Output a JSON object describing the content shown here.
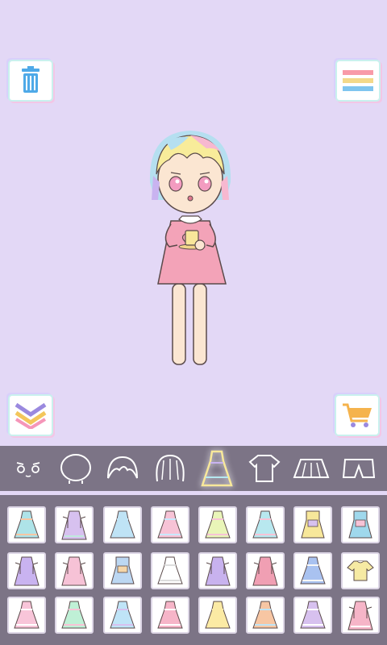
{
  "toolbar": {
    "trash_icon": "trash-icon",
    "menu_icon": "menu-icon",
    "collapse_icon": "chevron-down-icon",
    "shop_icon": "shopping-cart-icon"
  },
  "categories": [
    {
      "id": "face",
      "icon": "face-icon"
    },
    {
      "id": "head",
      "icon": "head-icon"
    },
    {
      "id": "bangs",
      "icon": "bangs-icon"
    },
    {
      "id": "hair",
      "icon": "hair-icon"
    },
    {
      "id": "dress",
      "icon": "dress-icon",
      "active": true
    },
    {
      "id": "tshirt",
      "icon": "tshirt-icon"
    },
    {
      "id": "skirt",
      "icon": "skirt-icon"
    },
    {
      "id": "pants",
      "icon": "pants-icon"
    }
  ],
  "items": [
    {
      "shape": "dress",
      "color": "#aee3e8",
      "trim": "#f7c6a3"
    },
    {
      "shape": "long-dress",
      "color": "#d7c1ef",
      "trim": "#bfe9dd"
    },
    {
      "shape": "dress",
      "color": "#bfe3f5",
      "trim": "#bfe3f5"
    },
    {
      "shape": "dress",
      "color": "#f7c3d6",
      "trim": "#c8e8ff"
    },
    {
      "shape": "dress",
      "color": "#e9f5b8",
      "trim": "#f7c3d6"
    },
    {
      "shape": "dress",
      "color": "#b8e8ef",
      "trim": "#f7c3d6"
    },
    {
      "shape": "overall",
      "color": "#f7e79a",
      "trim": "#d7c1ef"
    },
    {
      "shape": "overall",
      "color": "#9fd8ec",
      "trim": "#f7c3d6"
    },
    {
      "shape": "long-dress",
      "color": "#c9b3f0",
      "trim": "#c9b3f0"
    },
    {
      "shape": "long-dress",
      "color": "#f6c2d6",
      "trim": "#f6c2d6"
    },
    {
      "shape": "overall",
      "color": "#bcd7f2",
      "trim": "#f5d5a8"
    },
    {
      "shape": "dress",
      "color": "#ffffff",
      "trim": "#dddddd"
    },
    {
      "shape": "long-dress",
      "color": "#c8b2ee",
      "trim": "#c8b2ee"
    },
    {
      "shape": "long-dress",
      "color": "#f09fb3",
      "trim": "#f09fb3"
    },
    {
      "shape": "dress",
      "color": "#a9c2f0",
      "trim": "#f7f7f7"
    },
    {
      "shape": "top",
      "color": "#f6eaa3",
      "trim": "#f7f7f7"
    },
    {
      "shape": "dress",
      "color": "#f8c5d9",
      "trim": "#ffffff"
    },
    {
      "shape": "dress",
      "color": "#bff0d6",
      "trim": "#f7c3d6"
    },
    {
      "shape": "dress",
      "color": "#bfe4f7",
      "trim": "#d7c1ef"
    },
    {
      "shape": "dress",
      "color": "#f6b5c8",
      "trim": "#ffffff"
    },
    {
      "shape": "dress",
      "color": "#fbeaa4",
      "trim": "#fbeaa4"
    },
    {
      "shape": "dress",
      "color": "#f7c6a3",
      "trim": "#bfe3f5"
    },
    {
      "shape": "dress",
      "color": "#d7c1ef",
      "trim": "#ffffff"
    },
    {
      "shape": "long-dress",
      "color": "#f6b5c8",
      "trim": "#ffffff"
    }
  ]
}
